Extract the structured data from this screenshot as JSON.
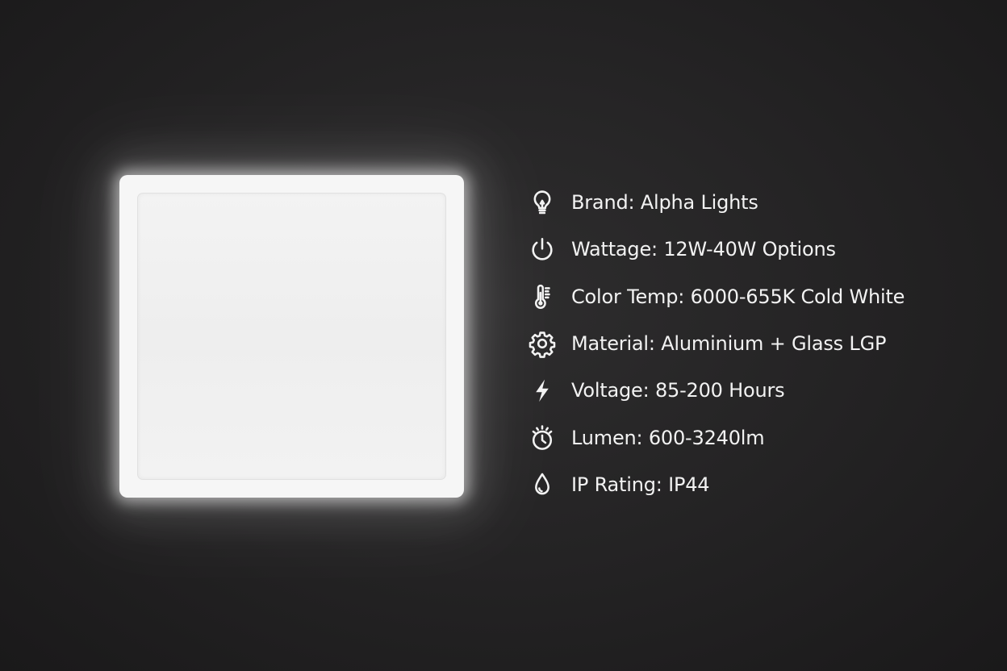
{
  "product": {
    "panel_label": "square LED panel light"
  },
  "specs": [
    {
      "icon": "lightbulb-icon",
      "text": "Brand: Alpha Lights"
    },
    {
      "icon": "power-icon",
      "text": "Wattage: 12W-40W Options"
    },
    {
      "icon": "thermometer-icon",
      "text": "Color Temp: 6000-655K Cold White"
    },
    {
      "icon": "gear-icon",
      "text": "Material: Aluminium + Glass LGP"
    },
    {
      "icon": "lightning-bolt-icon",
      "text": "Voltage: 85-200 Hours"
    },
    {
      "icon": "timer-icon",
      "text": "Lumen: 600-3240lm"
    },
    {
      "icon": "water-drop-icon",
      "text": "IP Rating: IP44"
    }
  ]
}
